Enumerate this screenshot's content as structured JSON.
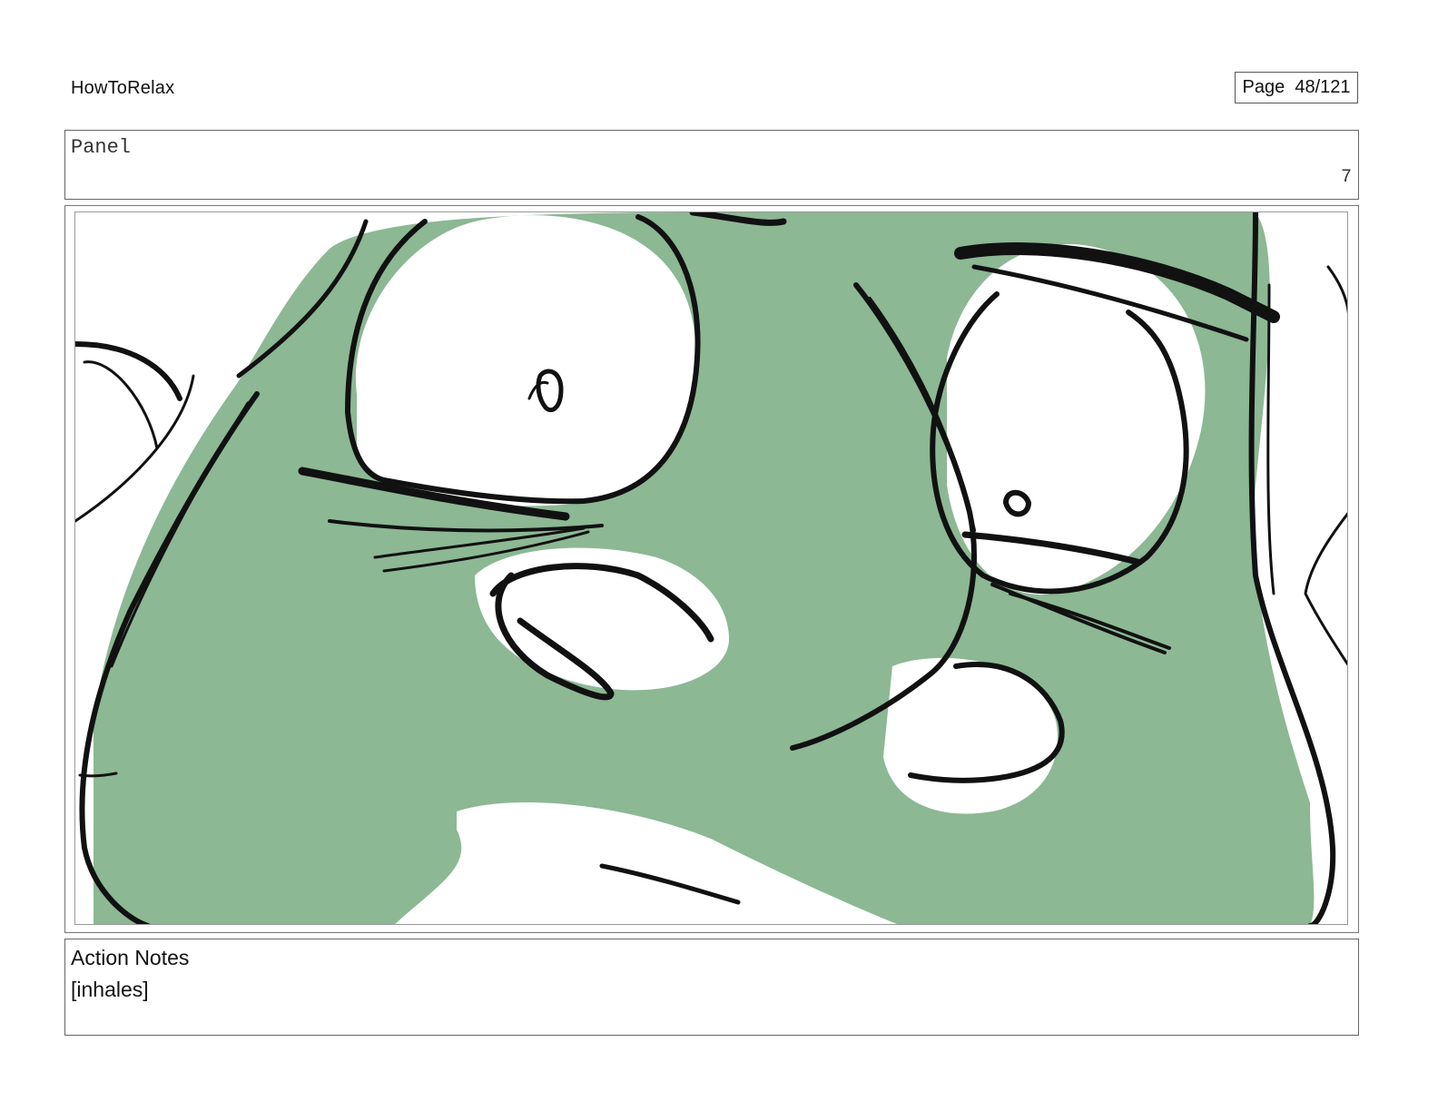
{
  "header": {
    "project_title": "HowToRelax",
    "page_label": "Page  48/121"
  },
  "panel": {
    "label": "Panel",
    "number": "7"
  },
  "artwork": {
    "fill_color": "#8cb894",
    "line_color": "#111111"
  },
  "notes": {
    "title": "Action Notes",
    "text": "[inhales]"
  }
}
